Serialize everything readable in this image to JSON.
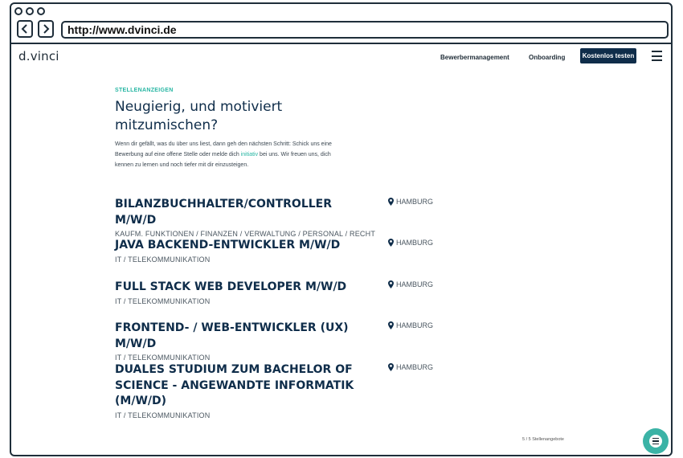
{
  "browser": {
    "url": "http://www.dvinci.de"
  },
  "header": {
    "logo": "d.vinci",
    "nav": [
      "Bewerbermanagement",
      "Onboarding"
    ],
    "cta_label": "Kostenlos testen"
  },
  "intro": {
    "kicker": "STELLENANZEIGEN",
    "heading": "Neugierig, und motiviert mitzumischen?",
    "text_before_link": "Wenn dir gefällt, was du über uns liest, dann geh den nächsten Schritt: Schick uns eine Bewerbung auf eine offene Stelle oder melde dich ",
    "link": "initiativ",
    "text_after_link": " bei uns. Wir freuen uns, dich kennen zu lernen und noch tiefer mit dir einzusteigen."
  },
  "jobs": [
    {
      "title": "BILANZBUCHHALTER/CONTROLLER M/W/D",
      "category": "KAUFM. FUNKTIONEN / FINANZEN / VERWALTUNG / PERSONAL / RECHT",
      "location": "HAMBURG"
    },
    {
      "title": "JAVA BACKEND-ENTWICKLER M/W/D",
      "category": "IT / TELEKOMMUNIKATION",
      "location": "HAMBURG"
    },
    {
      "title": "FULL STACK WEB DEVELOPER M/W/D",
      "category": "IT / TELEKOMMUNIKATION",
      "location": "HAMBURG"
    },
    {
      "title": "FRONTEND- / WEB-ENTWICKLER (UX) M/W/D",
      "category": "IT / TELEKOMMUNIKATION",
      "location": "HAMBURG"
    },
    {
      "title": "DUALES STUDIUM ZUM BACHELOR OF SCIENCE - ANGEWANDTE INFORMATIK (M/W/D)",
      "category": "IT / TELEKOMMUNIKATION",
      "location": "HAMBURG"
    }
  ],
  "footer": {
    "count": "5 / 5 Stellenangebote"
  },
  "icons": {
    "back": "chevron-left-icon",
    "forward": "chevron-right-icon",
    "menu": "hamburger-menu-icon",
    "location": "map-pin-icon",
    "chat": "chat-icon"
  },
  "colors": {
    "accent": "#27b6a3",
    "primary": "#0f2d4a",
    "chat": "#3bb3a6"
  }
}
